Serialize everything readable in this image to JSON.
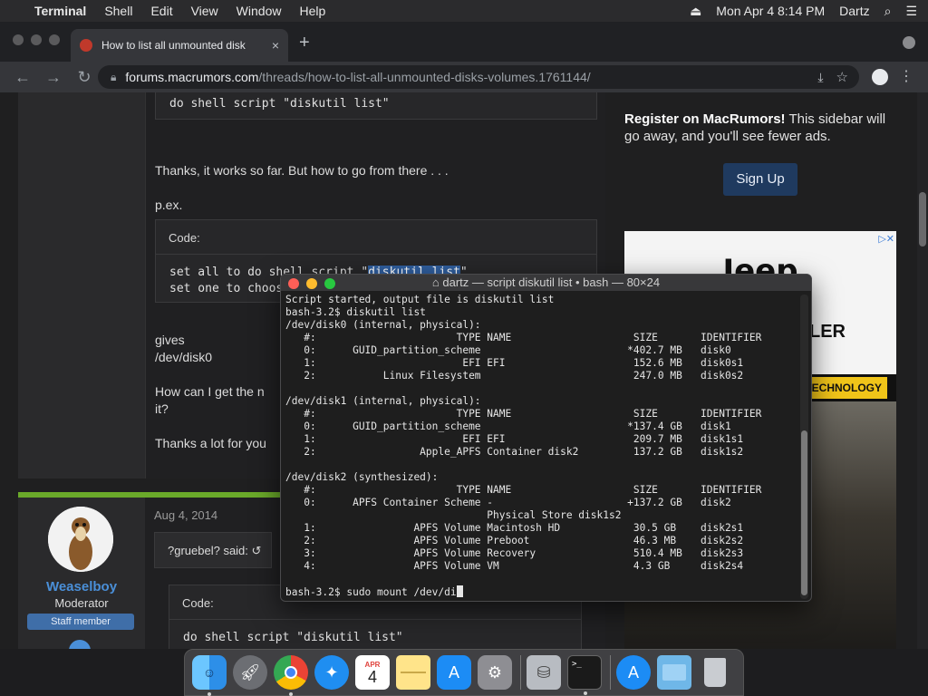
{
  "menubar": {
    "app": "Terminal",
    "items": [
      "Shell",
      "Edit",
      "View",
      "Window",
      "Help"
    ],
    "clock": "Mon Apr 4  8:14 PM",
    "user": "Dartz"
  },
  "browser": {
    "tab_title": "How to list all unmounted disk",
    "tab_close": "×",
    "new_tab": "+",
    "url_host": "forums.macrumors.com",
    "url_path": "/threads/how-to-list-all-unmounted-disks-volumes.1761144/"
  },
  "post1": {
    "code_top": "do shell script \"diskutil list\"",
    "text1": "Thanks, it works so far. But how to go from there . . .",
    "text2": "p.ex.",
    "code_label": "Code:",
    "code_line1_pre": "set all to do shell script \"",
    "code_line1_hl": "diskutil list",
    "code_line1_post": "\"",
    "code_line2": "set one to choos",
    "gives": "gives",
    "dev": "/dev/disk0",
    "question_a": "How can I get the n",
    "question_b": "it?",
    "thanks": "Thanks a lot for you"
  },
  "post2": {
    "username": "Weaselboy",
    "role": "Moderator",
    "badge": "Staff member",
    "date": "Aug 4, 2014",
    "quote": "?gruebel? said: ↺",
    "code_label": "Code:",
    "code": "do shell script \"diskutil list\""
  },
  "sidebar": {
    "register_bold": "Register on MacRumors!",
    "register_text": " This sidebar will go away, and you'll see fewer ads.",
    "signup": "Sign Up",
    "ad_brand": "Jeep",
    "ad_ler": "LER",
    "ad_tech": "TECHNOLOGY",
    "ad_close": "▷✕"
  },
  "terminal": {
    "title": "dartz — script diskutil list • bash — 80×24",
    "lines": [
      "Script started, output file is diskutil list",
      "bash-3.2$ diskutil list",
      "/dev/disk0 (internal, physical):",
      "   #:                       TYPE NAME                    SIZE       IDENTIFIER",
      "   0:      GUID_partition_scheme                        *402.7 MB   disk0",
      "   1:                        EFI EFI                     152.6 MB   disk0s1",
      "   2:           Linux Filesystem                         247.0 MB   disk0s2",
      "",
      "/dev/disk1 (internal, physical):",
      "   #:                       TYPE NAME                    SIZE       IDENTIFIER",
      "   0:      GUID_partition_scheme                        *137.4 GB   disk1",
      "   1:                        EFI EFI                     209.7 MB   disk1s1",
      "   2:                 Apple_APFS Container disk2         137.2 GB   disk1s2",
      "",
      "/dev/disk2 (synthesized):",
      "   #:                       TYPE NAME                    SIZE       IDENTIFIER",
      "   0:      APFS Container Scheme -                      +137.2 GB   disk2",
      "                                 Physical Store disk1s2",
      "   1:                APFS Volume Macintosh HD            30.5 GB    disk2s1",
      "   2:                APFS Volume Preboot                 46.3 MB    disk2s2",
      "   3:                APFS Volume Recovery                510.4 MB   disk2s3",
      "   4:                APFS Volume VM                      4.3 GB     disk2s4",
      ""
    ],
    "prompt": "bash-3.2$ sudo mount /dev/di"
  },
  "dock": {
    "apps": [
      "finder-icon",
      "launchpad-icon",
      "chrome-icon",
      "safari-icon",
      "calendar-icon",
      "notes-icon",
      "app-store-icon",
      "system-preferences-icon",
      "disk-utility-icon",
      "terminal-icon",
      "app-store-downloads-icon",
      "folder-icon",
      "trash-icon"
    ],
    "calendar_month": "APR",
    "calendar_day": "4"
  }
}
